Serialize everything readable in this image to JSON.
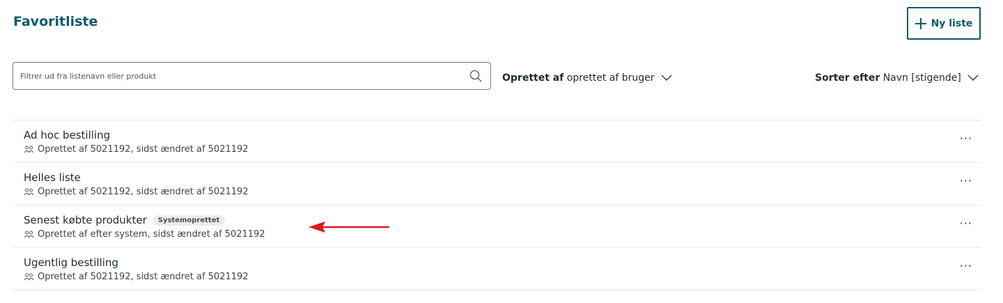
{
  "header": {
    "title": "Favoritliste",
    "new_list_label": "Ny liste"
  },
  "search": {
    "placeholder": "Filtrer ud fra listenavn eller produkt",
    "value": ""
  },
  "filters": {
    "created_by_label": "Oprettet af",
    "created_by_value": "oprettet af bruger",
    "sort_label": "Sorter efter",
    "sort_value": "Navn [stigende]"
  },
  "lists": [
    {
      "name": "Ad hoc bestilling",
      "badge": "",
      "meta": "Oprettet af 5021192, sidst ændret af 5021192"
    },
    {
      "name": "Helles liste",
      "badge": "",
      "meta": "Oprettet af 5021192, sidst ændret af 5021192"
    },
    {
      "name": "Senest købte produkter",
      "badge": "Systemoprettet",
      "meta": "Oprettet af efter system, sidst ændret af 5021192"
    },
    {
      "name": "Ugentlig bestilling",
      "badge": "",
      "meta": "Oprettet af 5021192, sidst ændret af 5021192"
    }
  ],
  "more_label": "···",
  "icons": {
    "add": "plus-icon",
    "search": "search-icon",
    "dropdown": "chevron-down-icon",
    "owner": "users-icon",
    "row_menu": "more-options-icon",
    "annotation": "red-arrow-icon"
  },
  "colors": {
    "accent": "#0e5a6e",
    "annotation_arrow": "#e3161b",
    "badge_bg": "#ececec"
  }
}
